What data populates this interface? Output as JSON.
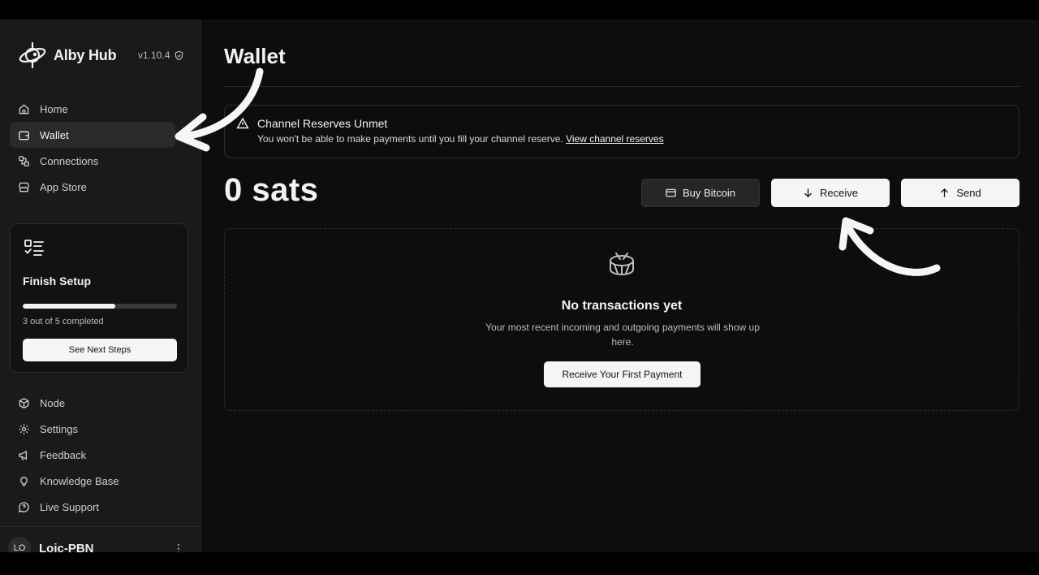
{
  "brand": {
    "name": "Alby Hub",
    "version": "v1.10.4"
  },
  "sidebar": {
    "items_top": [
      {
        "label": "Home",
        "icon": "home-icon"
      },
      {
        "label": "Wallet",
        "icon": "wallet-icon",
        "active": true
      },
      {
        "label": "Connections",
        "icon": "connections-icon"
      },
      {
        "label": "App Store",
        "icon": "store-icon"
      }
    ],
    "setup": {
      "title": "Finish Setup",
      "progress_fraction": 0.6,
      "status": "3 out of 5 completed",
      "button": "See Next Steps"
    },
    "items_bottom": [
      {
        "label": "Node",
        "icon": "box-icon"
      },
      {
        "label": "Settings",
        "icon": "gear-icon"
      },
      {
        "label": "Feedback",
        "icon": "megaphone-icon"
      },
      {
        "label": "Knowledge Base",
        "icon": "lightbulb-icon"
      },
      {
        "label": "Live Support",
        "icon": "chat-icon"
      }
    ],
    "user": {
      "initials": "LO",
      "name": "Loic-PBN"
    }
  },
  "main": {
    "title": "Wallet",
    "alert": {
      "title": "Channel Reserves Unmet",
      "body": "You won't be able to make payments until you fill your channel reserve. ",
      "link": "View channel reserves"
    },
    "balance": "0 sats",
    "actions": {
      "buy": "Buy Bitcoin",
      "receive": "Receive",
      "send": "Send"
    },
    "empty": {
      "title": "No transactions yet",
      "description": "Your most recent incoming and outgoing payments will show up here.",
      "button": "Receive Your First Payment"
    }
  },
  "colors": {
    "background": "#0d0d0d",
    "sidebar": "#1a1a1a",
    "accent": "#f5f5f5"
  }
}
